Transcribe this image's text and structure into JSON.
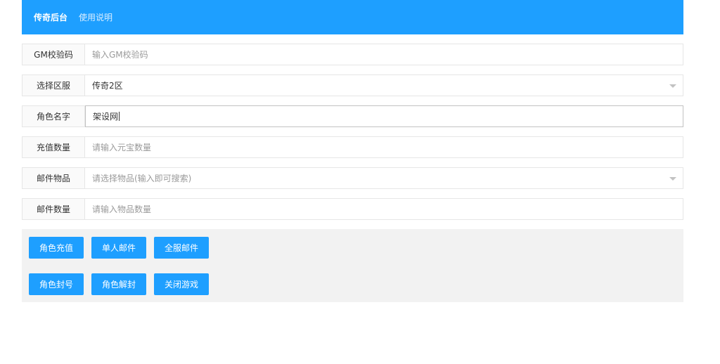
{
  "header": {
    "brand": "传奇后台",
    "nav_link": "使用说明"
  },
  "form": {
    "gm_code": {
      "label": "GM校验码",
      "placeholder": "输入GM校验码",
      "value": ""
    },
    "server": {
      "label": "选择区服",
      "value": "传奇2区"
    },
    "role_name": {
      "label": "角色名字",
      "value": "架设网"
    },
    "recharge_amount": {
      "label": "充值数量",
      "placeholder": "请输入元宝数量",
      "value": ""
    },
    "mail_item": {
      "label": "邮件物品",
      "placeholder": "请选择物品(输入即可搜索)"
    },
    "mail_quantity": {
      "label": "邮件数量",
      "placeholder": "请输入物品数量",
      "value": ""
    }
  },
  "actions": {
    "row1": [
      "角色充值",
      "单人邮件",
      "全服邮件"
    ],
    "row2": [
      "角色封号",
      "角色解封",
      "关闭游戏"
    ]
  },
  "colors": {
    "primary": "#1e9fff",
    "panel_bg": "#f2f2f2"
  }
}
